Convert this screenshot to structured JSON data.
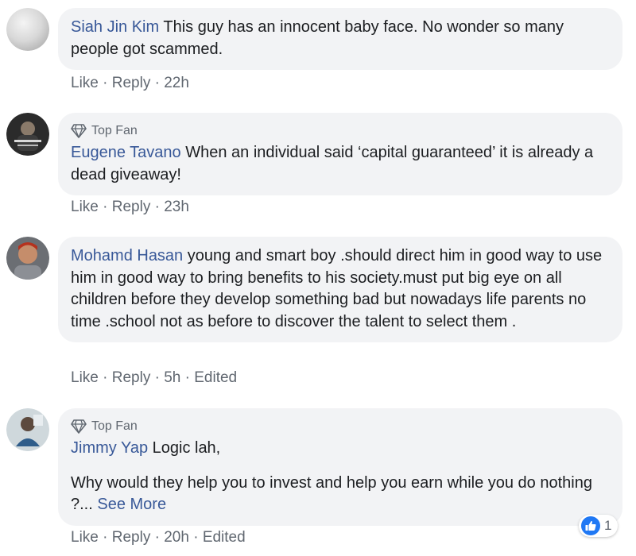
{
  "comments": [
    {
      "author": "Siah Jin Kim",
      "text": "This guy has an innocent baby face. No wonder so many people got scammed.",
      "actions": {
        "like": "Like",
        "reply": "Reply",
        "time": "22h"
      }
    },
    {
      "badge": "Top Fan",
      "author": "Eugene Tavano",
      "text": "When an individual said ‘capital guaranteed’ it is already a dead giveaway!",
      "actions": {
        "like": "Like",
        "reply": "Reply",
        "time": "23h"
      }
    },
    {
      "author": "Mohamd Hasan",
      "text": "young and smart boy .should direct him in good way to use him in good way to bring benefits to his society.must put big eye on all children before they develop something bad but nowadays life parents no time .school not as before to discover the talent to select them .",
      "actions": {
        "like": "Like",
        "reply": "Reply",
        "time": "5h",
        "edited": "Edited"
      }
    },
    {
      "badge": "Top Fan",
      "author": "Jimmy Yap",
      "text": "Logic lah,",
      "text2": "Why would they help you to invest and help you earn while you do nothing ?...",
      "see_more": "See More",
      "reaction_count": "1",
      "actions": {
        "like": "Like",
        "reply": "Reply",
        "time": "20h",
        "edited": "Edited"
      }
    }
  ],
  "separator": " · ",
  "icons": {
    "badge": "diamond-icon",
    "reaction": "thumbs-up-icon"
  },
  "colors": {
    "author": "#385898",
    "bubble": "#f2f3f5",
    "meta": "#606770",
    "like": "#2078f4"
  }
}
